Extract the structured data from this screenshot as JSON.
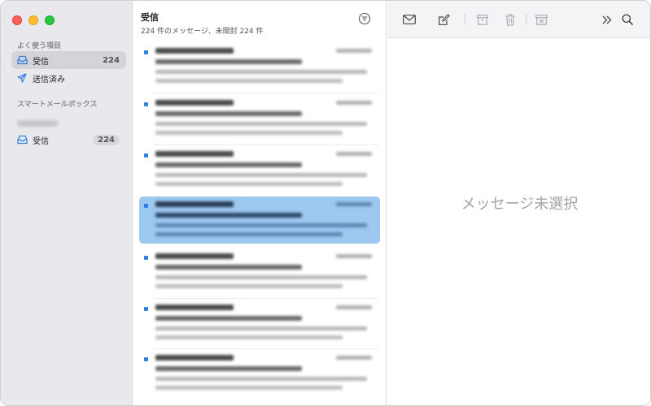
{
  "sidebar": {
    "favorites_label": "よく使う項目",
    "items": [
      {
        "label": "受信",
        "count": "224"
      },
      {
        "label": "送信済み",
        "count": ""
      }
    ],
    "smart_label": "スマートメールボックス",
    "account_items": [
      {
        "label": "受信",
        "count": "224"
      }
    ]
  },
  "list": {
    "title": "受信",
    "subtitle": "224 件のメッセージ、未開封 224 件"
  },
  "detail": {
    "empty_text": "メッセージ未選択"
  },
  "colors": {
    "accent": "#2d7fe0",
    "selection": "#9dc8ef",
    "sidebar_bg": "#e9e9ed"
  },
  "icons": {
    "inbox": "tray-icon",
    "sent": "paperplane-icon",
    "filter": "filter-icon",
    "get_mail": "envelope-icon",
    "compose": "compose-icon",
    "archive": "archive-icon",
    "trash": "trash-icon",
    "junk": "junk-icon",
    "more": "chevrons-right-icon",
    "search": "search-icon"
  }
}
